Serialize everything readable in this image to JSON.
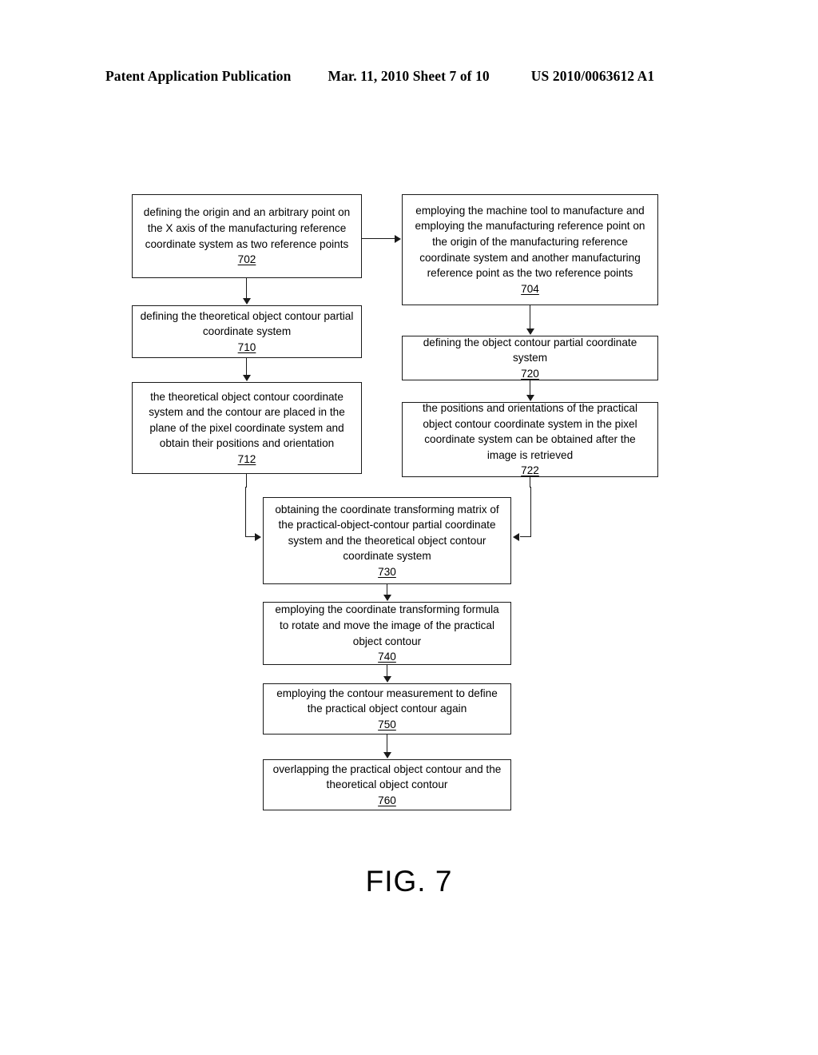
{
  "header": {
    "publication": "Patent Application Publication",
    "date_sheet": "Mar. 11, 2010  Sheet 7 of 10",
    "patent_number": "US 2010/0063612 A1"
  },
  "figure": {
    "caption": "FIG. 7"
  },
  "flowchart": {
    "type": "flowchart",
    "boxes": [
      {
        "id": "702",
        "text": "defining the origin and an arbitrary point on the X axis of the manufacturing reference coordinate system as two reference points",
        "number": "702"
      },
      {
        "id": "704",
        "text": "employing the machine tool to manufacture and employing the manufacturing reference point on the origin of the manufacturing reference coordinate system and another manufacturing reference point as the two reference points",
        "number": "704"
      },
      {
        "id": "710",
        "text": "defining the theoretical object contour partial coordinate system",
        "number": "710"
      },
      {
        "id": "720",
        "text": "defining the object contour partial coordinate system",
        "number": "720"
      },
      {
        "id": "712",
        "text": "the theoretical object contour coordinate system and the contour are placed in the plane of the pixel coordinate system and obtain their positions and orientation",
        "number": "712"
      },
      {
        "id": "722",
        "text": "the positions and orientations of the practical object contour coordinate system in the pixel coordinate system can be obtained after the image is retrieved",
        "number": "722"
      },
      {
        "id": "730",
        "text": "obtaining the coordinate transforming matrix of the practical-object-contour partial coordinate system and the theoretical object contour coordinate system",
        "number": "730"
      },
      {
        "id": "740",
        "text": "employing the coordinate transforming formula to rotate and move the image of the practical object contour",
        "number": "740"
      },
      {
        "id": "750",
        "text": "employing the contour measurement to define the practical object contour again",
        "number": "750"
      },
      {
        "id": "760",
        "text": "overlapping the practical object contour and the theoretical object contour",
        "number": "760"
      }
    ],
    "edges": [
      {
        "from": "702",
        "to": "704",
        "direction": "right"
      },
      {
        "from": "702",
        "to": "710",
        "direction": "down"
      },
      {
        "from": "710",
        "to": "712",
        "direction": "down"
      },
      {
        "from": "704",
        "to": "720",
        "direction": "down"
      },
      {
        "from": "720",
        "to": "722",
        "direction": "down"
      },
      {
        "from": "712",
        "to": "730",
        "direction": "elbow-down-right"
      },
      {
        "from": "722",
        "to": "730",
        "direction": "elbow-down-left"
      },
      {
        "from": "730",
        "to": "740",
        "direction": "down"
      },
      {
        "from": "740",
        "to": "750",
        "direction": "down"
      },
      {
        "from": "750",
        "to": "760",
        "direction": "down"
      }
    ]
  }
}
